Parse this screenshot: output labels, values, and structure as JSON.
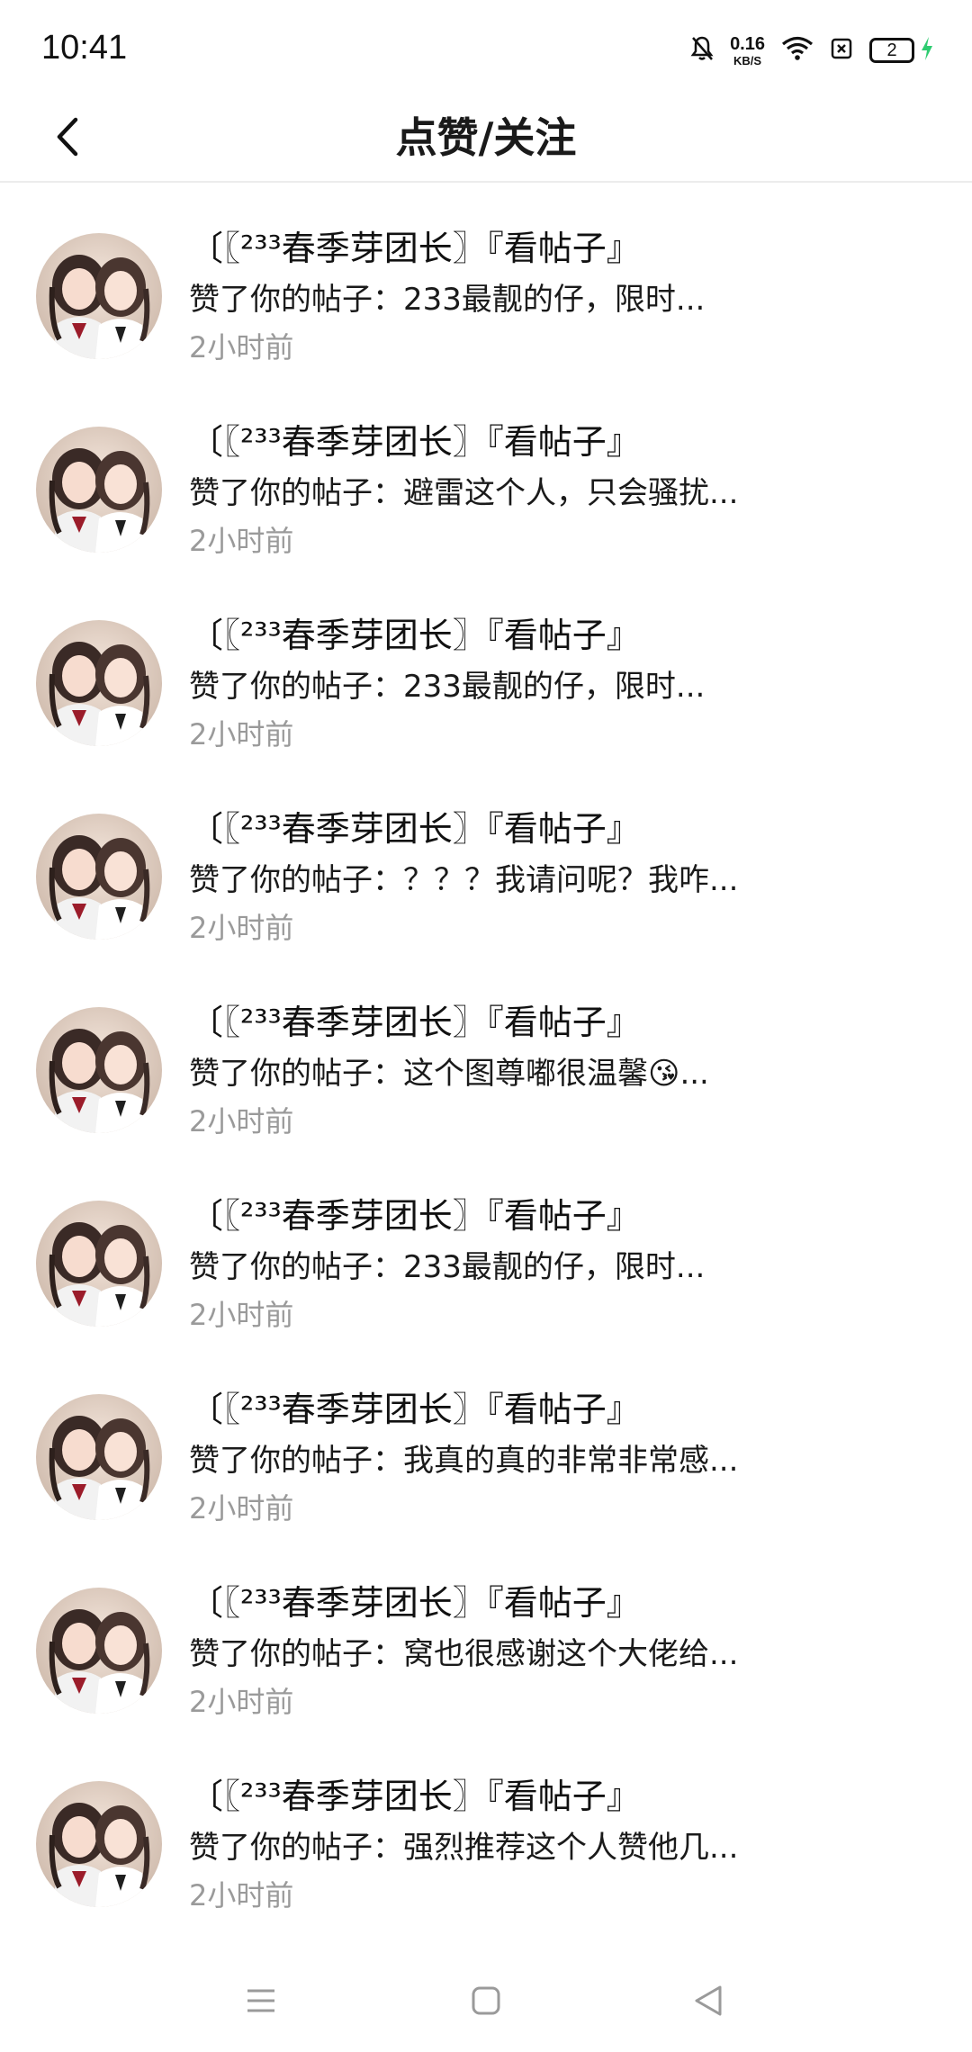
{
  "status_bar": {
    "time": "10:41",
    "net_speed_value": "0.16",
    "net_speed_unit": "KB/S",
    "battery_level": "2",
    "icons": [
      "mute-bell-icon",
      "wifi-icon",
      "sim-icon",
      "battery-icon",
      "charging-icon"
    ]
  },
  "header": {
    "title": "点赞/关注",
    "back_icon": "chevron-left-icon"
  },
  "notifications": [
    {
      "name": "〔〖²³³春季芽团长〗『看帖子』",
      "action": "赞了你的帖子：233最靓的仔，限时...",
      "time": "2小时前"
    },
    {
      "name": "〔〖²³³春季芽团长〗『看帖子』",
      "action": "赞了你的帖子：避雷这个人，只会骚扰...",
      "time": "2小时前"
    },
    {
      "name": "〔〖²³³春季芽团长〗『看帖子』",
      "action": "赞了你的帖子：233最靓的仔，限时...",
      "time": "2小时前"
    },
    {
      "name": "〔〖²³³春季芽团长〗『看帖子』",
      "action": "赞了你的帖子：？？？我请问呢？我咋...",
      "time": "2小时前"
    },
    {
      "name": "〔〖²³³春季芽团长〗『看帖子』",
      "action": "赞了你的帖子：这个图尊嘟很温馨😘...",
      "time": "2小时前"
    },
    {
      "name": "〔〖²³³春季芽团长〗『看帖子』",
      "action": "赞了你的帖子：233最靓的仔，限时...",
      "time": "2小时前"
    },
    {
      "name": "〔〖²³³春季芽团长〗『看帖子』",
      "action": "赞了你的帖子：我真的真的非常非常感...",
      "time": "2小时前"
    },
    {
      "name": "〔〖²³³春季芽团长〗『看帖子』",
      "action": "赞了你的帖子：窝也很感谢这个大佬给...",
      "time": "2小时前"
    },
    {
      "name": "〔〖²³³春季芽团长〗『看帖子』",
      "action": "赞了你的帖子：强烈推荐这个人赞他几...",
      "time": "2小时前"
    }
  ],
  "nav_bar": {
    "icons": [
      "menu-icon",
      "home-square-icon",
      "back-triangle-icon"
    ]
  },
  "colors": {
    "background": "#ffffff",
    "text_primary": "#1a1a1a",
    "text_secondary": "#9a9a9a",
    "charging": "#2ecc71",
    "divider": "#ececec"
  }
}
